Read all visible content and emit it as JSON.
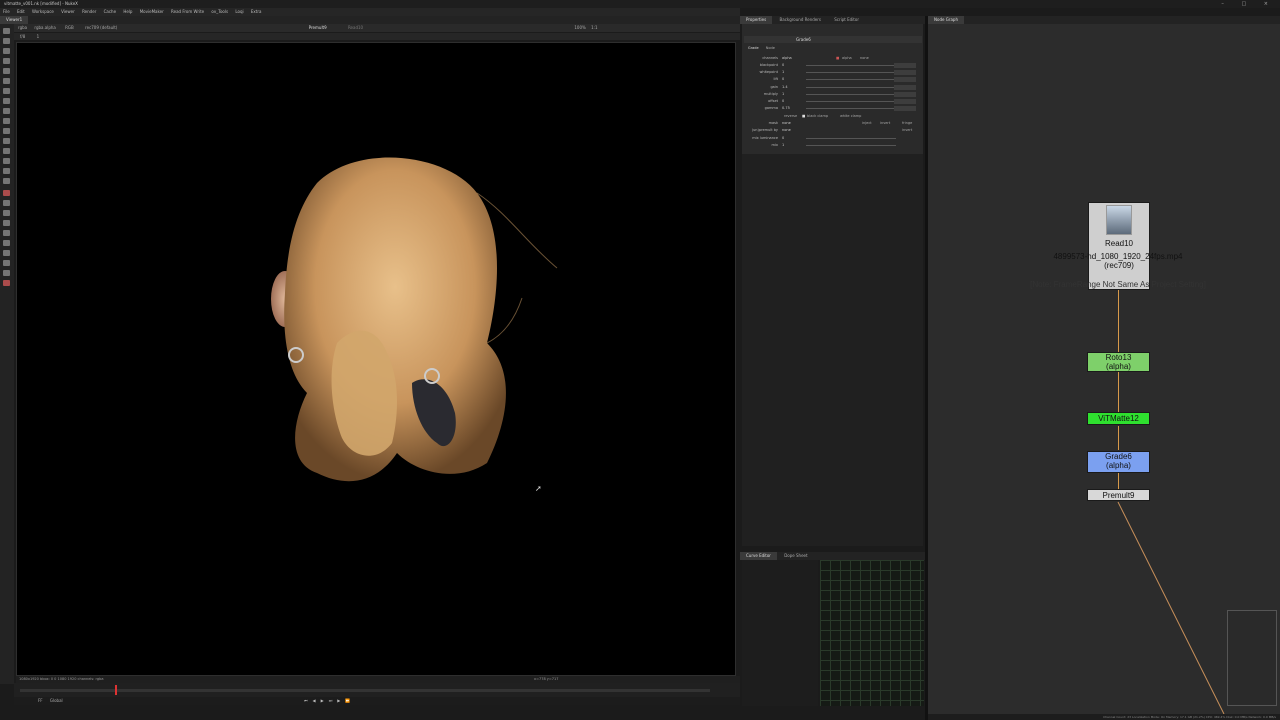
{
  "window": {
    "title": "vitmatte_v001.nk [modified] - NukeX",
    "controls": "– □ ×"
  },
  "menu": [
    "File",
    "Edit",
    "Workspace",
    "Viewer",
    "Render",
    "Cache",
    "Help",
    "MovieMaker",
    "Read From Write",
    "ov_Tools",
    "Loqi",
    "Extra"
  ],
  "viewer": {
    "tab": "Viewer1",
    "bar1": {
      "channels": "rgba",
      "layer": "rgba.alpha",
      "display": "RGB",
      "lut": "rec709 (default)",
      "node_a": "Premult9",
      "node_b": "Read10",
      "zoom": "100%",
      "ratio": "1:1"
    },
    "bar2": {
      "frame": "f/8",
      "gain": "1"
    },
    "info": "1080x1920  bbox: 0 0 1080 1920 channels: rgba",
    "coords": "x=778 y=717",
    "playback": {
      "fps": "FF",
      "mode": "Global"
    }
  },
  "properties": {
    "tabs": [
      "Properties",
      "Background Renders",
      "Script Editor"
    ],
    "node_name": "Grade6",
    "subtabs": [
      "Grade",
      "Node"
    ],
    "channels": {
      "label": "channels",
      "value": "alpha",
      "check": "alpha",
      "mask": "none"
    },
    "rows": [
      {
        "label": "blackpoint",
        "value": "0"
      },
      {
        "label": "whitepoint",
        "value": "1"
      },
      {
        "label": "lift",
        "value": "0"
      },
      {
        "label": "gain",
        "value": "1.4"
      },
      {
        "label": "multiply",
        "value": "1"
      },
      {
        "label": "offset",
        "value": "0"
      },
      {
        "label": "gamma",
        "value": "0.75"
      }
    ],
    "options": {
      "reverse": "reverse",
      "black_clamp": "black clamp",
      "white_clamp": "white clamp"
    },
    "mask": {
      "label": "mask",
      "value": "none",
      "inject": "inject",
      "invert": "invert",
      "fringe": "fringe"
    },
    "unpremult": {
      "label": "(un)premult by",
      "value": "none",
      "invert": "invert"
    },
    "mix_lum": {
      "label": "mix luminance",
      "value": "0"
    },
    "mix": {
      "label": "mix",
      "value": "1"
    }
  },
  "curve_tabs": [
    "Curve Editor",
    "Dope Sheet"
  ],
  "node_graph": {
    "tab": "Node Graph",
    "read": {
      "name": "Read10",
      "file": "4899573-hd_1080_1920_24fps.mp4",
      "cs": "(rec709)",
      "note": "[Note: FrameRange Not Same As Project Setting]"
    },
    "roto": {
      "name": "Roto13",
      "sub": "(alpha)"
    },
    "vitmatte": {
      "name": "ViTMatte12"
    },
    "grade": {
      "name": "Grade6",
      "sub": "(alpha)"
    },
    "premult": {
      "name": "Premult9"
    },
    "colors": {
      "roto": "#7ed06a",
      "vitmatte": "#2fe02f",
      "grade": "#7ba0f0",
      "premult": "#d8d8d8",
      "read": "#cfcfcf",
      "pipe": "#d89a4a"
    }
  },
  "status": "Channel Count: 23  Localization Mode: On  Memory: 17.1 GB (21.2%)  CPU: 469.4%  Disk: 0.0 MB/s  Network: 0.0 MB/s"
}
